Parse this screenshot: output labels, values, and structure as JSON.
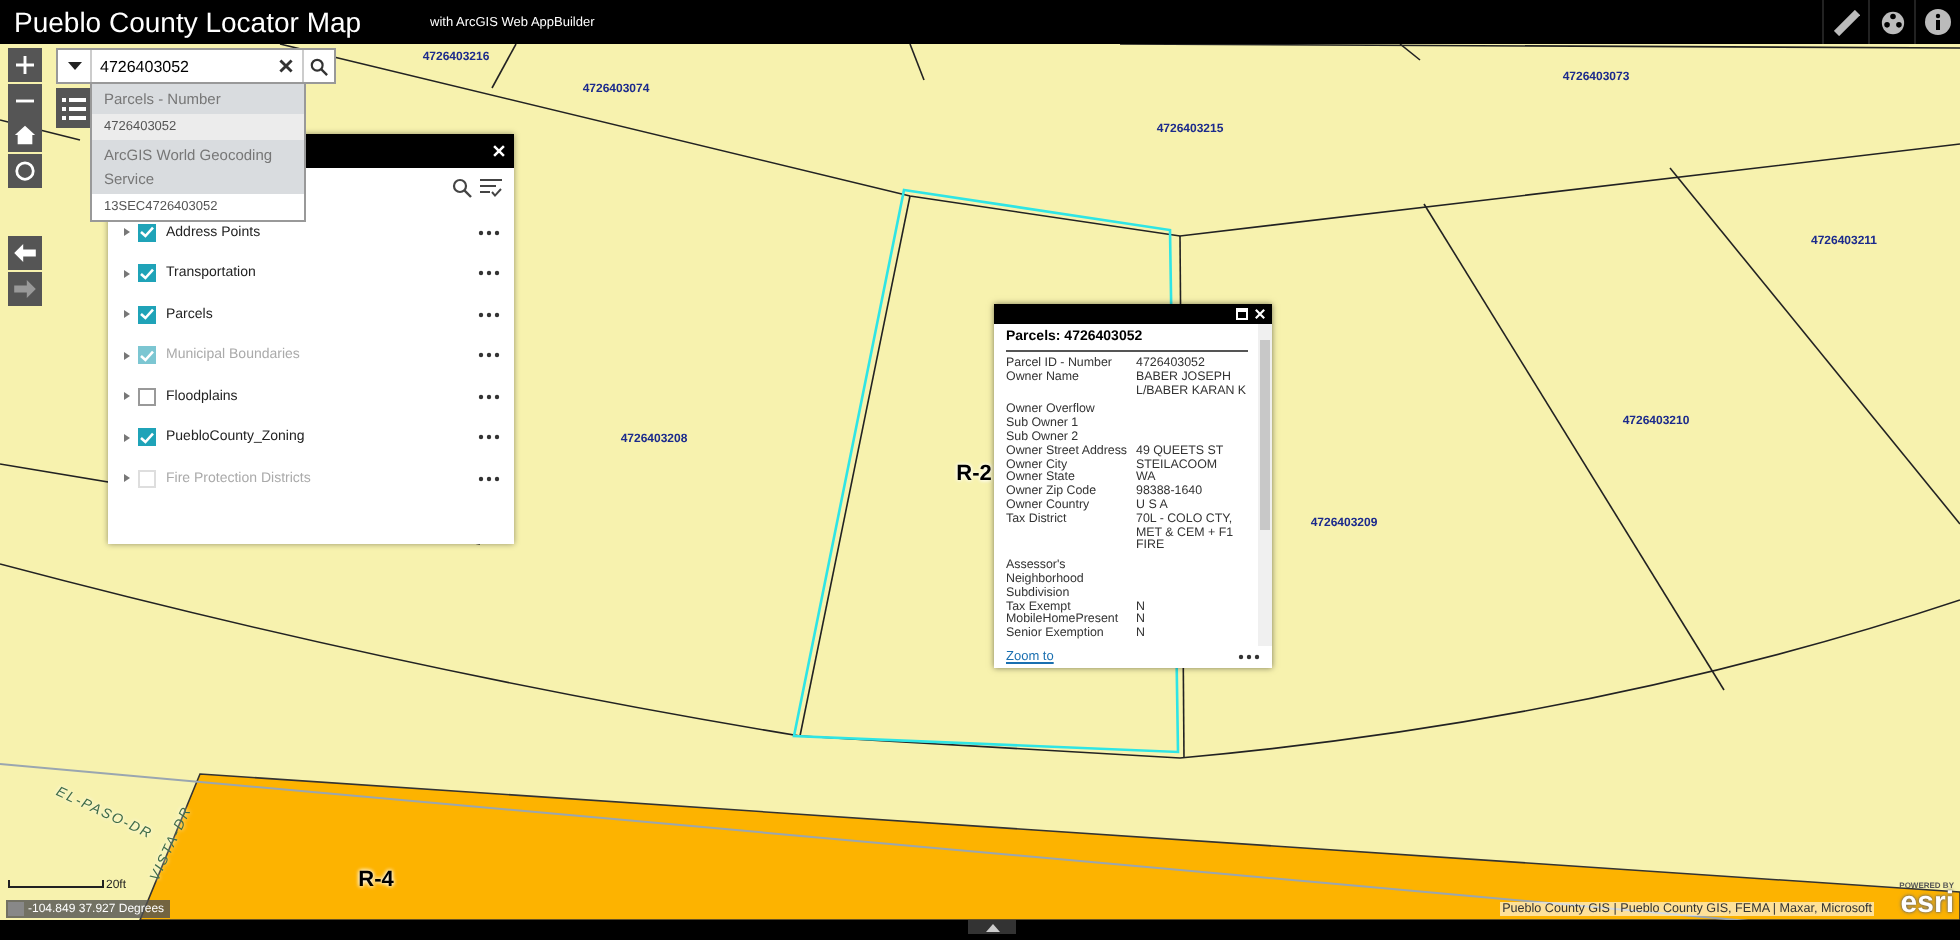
{
  "header": {
    "title": "Pueblo County Locator Map",
    "subtitle": "with ArcGIS Web AppBuilder"
  },
  "search": {
    "value": "4726403052",
    "suggestions": [
      {
        "kind": "group",
        "text": "Parcels - Number"
      },
      {
        "kind": "item",
        "text": "4726403052",
        "selected": true
      },
      {
        "kind": "group",
        "text": "ArcGIS World Geocoding Service"
      },
      {
        "kind": "item",
        "text": "13SEC4726403052",
        "selected": false
      }
    ]
  },
  "layer_list": {
    "layers": [
      {
        "name": "Address Points",
        "checked": true,
        "disabled": false
      },
      {
        "name": "Transportation",
        "checked": true,
        "disabled": false
      },
      {
        "name": "Parcels",
        "checked": true,
        "disabled": false
      },
      {
        "name": "Municipal Boundaries",
        "checked": true,
        "disabled": true
      },
      {
        "name": "Floodplains",
        "checked": false,
        "disabled": false
      },
      {
        "name": "PuebloCounty_Zoning",
        "checked": true,
        "disabled": false
      },
      {
        "name": "Fire Protection Districts",
        "checked": false,
        "disabled": true
      }
    ]
  },
  "popup": {
    "title": "Parcels: 4726403052",
    "link": "Zoom to",
    "fields": [
      {
        "label": "Parcel ID - Number",
        "value": "4726403052"
      },
      {
        "label": "Owner Name",
        "value": "BABER JOSEPH L/BABER KARAN K"
      },
      {
        "label": "Owner Overflow"
      },
      {
        "label": "Sub Owner 1"
      },
      {
        "label": "Sub Owner 2"
      },
      {
        "label": "Owner Street Address",
        "value": "49 QUEETS ST"
      },
      {
        "label": "Owner City",
        "value": "STEILACOOM"
      },
      {
        "label": "Owner State",
        "value": "WA"
      },
      {
        "label": "Owner Zip Code",
        "value": "98388-1640"
      },
      {
        "label": "Owner Country",
        "value": "U S A"
      },
      {
        "label": "Tax District",
        "value": "70L - COLO CTY, MET & CEM + F1 FIRE"
      },
      {
        "label": "Assessor's Neighborhood Subdivision"
      },
      {
        "label": "Tax Exempt",
        "value": "N"
      },
      {
        "label": "MobileHomePresent",
        "value": "N"
      },
      {
        "label": "Senior Exemption",
        "value": "N"
      }
    ]
  },
  "map": {
    "labels": [
      {
        "text": "4726403216",
        "kind": "parcel"
      },
      {
        "text": "4726403074",
        "kind": "parcel"
      },
      {
        "text": "4726403073",
        "kind": "parcel"
      },
      {
        "text": "4726403215",
        "kind": "parcel"
      },
      {
        "text": "4726403211",
        "kind": "parcel"
      },
      {
        "text": "4726403208",
        "kind": "parcel"
      },
      {
        "text": "4726403210",
        "kind": "parcel"
      },
      {
        "text": "4726403209",
        "kind": "parcel"
      },
      {
        "text": "R-2",
        "kind": "zone"
      },
      {
        "text": "R-4",
        "kind": "zone"
      },
      {
        "text": "EL-PASO-DR",
        "kind": "road"
      },
      {
        "text": "VISTA-DR",
        "kind": "road"
      }
    ]
  },
  "scale": "20ft",
  "coordinates": "-104.849 37.927 Degrees",
  "attribution": "Pueblo County GIS | Pueblo County GIS, FEMA | Maxar, Microsoft",
  "logo": {
    "tagline": "POWERED BY",
    "text": "esri"
  }
}
